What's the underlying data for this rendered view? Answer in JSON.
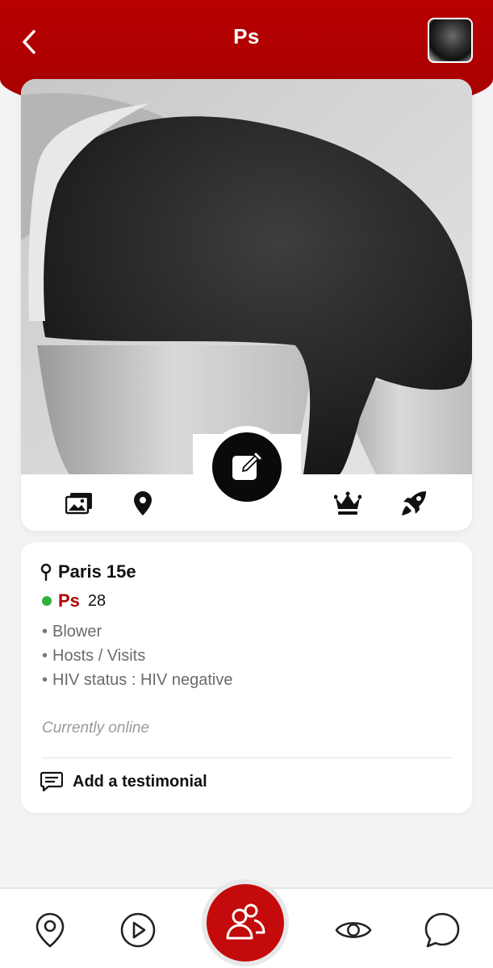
{
  "header": {
    "title": "Ps",
    "back_icon": "chevron-left-icon",
    "avatar": "profile-thumbnail"
  },
  "photo": {
    "edit_icon": "edit-icon",
    "actions": [
      {
        "icon": "gallery-icon"
      },
      {
        "icon": "location-pin-icon"
      },
      {
        "icon": "crown-icon"
      },
      {
        "icon": "rocket-icon"
      }
    ]
  },
  "profile": {
    "location": "Paris 15e",
    "name": "Ps",
    "age": "28",
    "online": true,
    "traits": [
      "Blower",
      "Hosts / Visits",
      "HIV status : HIV negative"
    ],
    "status_text": "Currently online",
    "testimonial_label": "Add a testimonial"
  },
  "bottom_nav": {
    "items": [
      {
        "icon": "map-pin-icon"
      },
      {
        "icon": "play-icon"
      },
      {
        "icon": "people-icon",
        "active": true
      },
      {
        "icon": "eye-icon"
      },
      {
        "icon": "chat-icon"
      }
    ]
  },
  "colors": {
    "brand_red": "#b80000",
    "online_green": "#2fb23a",
    "name_red": "#b30000"
  }
}
